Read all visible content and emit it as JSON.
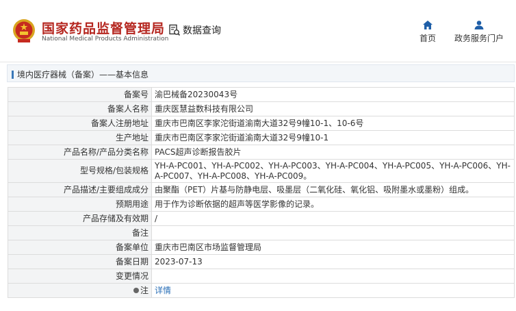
{
  "header": {
    "brand_cn": "国家药品监督管理局",
    "brand_en": "National Medical Products Administration",
    "search_label": "数据查询",
    "nav": [
      {
        "label": "首页",
        "icon": "home-icon"
      },
      {
        "label": "政务服务门户",
        "icon": "user-icon"
      }
    ]
  },
  "breadcrumb": {
    "text": "境内医疗器械（备案）——基本信息"
  },
  "record": {
    "rows": [
      {
        "key": "备案号",
        "value": "渝巴械备20230043号"
      },
      {
        "key": "备案人名称",
        "value": "重庆医慧益数科技有限公司"
      },
      {
        "key": "备案人注册地址",
        "value": "重庆市巴南区李家沱街道渝南大道32号9幢10-1、10-6号"
      },
      {
        "key": "生产地址",
        "value": "重庆市巴南区李家沱街道渝南大道32号9幢10-1"
      },
      {
        "key": "产品名称/产品分类名称",
        "value": "PACS超声诊断报告胶片"
      },
      {
        "key": "型号规格/包装规格",
        "value": "YH-A-PC001、YH-A-PC002、YH-A-PC003、YH-A-PC004、YH-A-PC005、YH-A-PC006、YH-A-PC007、YH-A-PC008、YH-A-PC009。"
      },
      {
        "key": "产品描述/主要组成成分",
        "value": "由聚酯（PET）片基与防静电层、吸墨层（二氧化硅、氧化铝、吸附墨水或墨粉）组成。"
      },
      {
        "key": "预期用途",
        "value": "用于作为诊断依据的超声等医学影像的记录。"
      },
      {
        "key": "产品存储及有效期",
        "value": "/"
      },
      {
        "key": "备注",
        "value": ""
      },
      {
        "key": "备案单位",
        "value": "重庆市巴南区市场监督管理局"
      },
      {
        "key": "备案日期",
        "value": "2023-07-13"
      },
      {
        "key": "变更情况",
        "value": ""
      }
    ],
    "note": {
      "key": "注",
      "link": "详情"
    }
  },
  "colors": {
    "brand_red": "#b5261f",
    "link_blue": "#2a6fb7",
    "accent_blue": "#1f5fa8"
  }
}
